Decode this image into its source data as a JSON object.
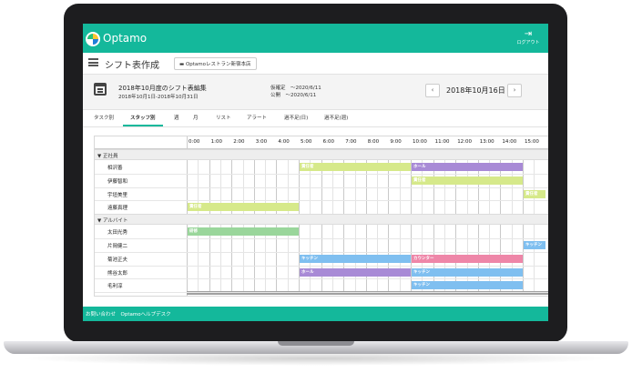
{
  "app": {
    "brand": "Optamo",
    "logout_label": "ログアウト",
    "logout_icon": "logout-icon"
  },
  "header": {
    "page_title": "シフト表作成",
    "store_button": "Optamoレストラン新宿本店",
    "menu_icon": "hamburger-icon"
  },
  "schedule": {
    "name": "2018年10月度のシフト表編集",
    "range": "2018年10月1日-2018年10月31日",
    "deadline": "仮確定　〜2020/6/11",
    "publish": "公開　〜2020/6/11",
    "current_date": "2018年10月16日",
    "prev_label": "‹",
    "next_label": "›"
  },
  "tabs": [
    {
      "label": "タスク別"
    },
    {
      "label": "スタッフ別"
    },
    {
      "label": "週"
    },
    {
      "label": "月"
    },
    {
      "label": "リスト"
    },
    {
      "label": "アラート"
    },
    {
      "label": "過不足(日)"
    },
    {
      "label": "過不足(週)"
    }
  ],
  "active_tab": "スタッフ別",
  "timeline": {
    "hours": [
      "0:00",
      "1:00",
      "2:00",
      "3:00",
      "4:00",
      "5:00",
      "6:00",
      "7:00",
      "8:00",
      "9:00",
      "10:00",
      "11:00",
      "12:00",
      "13:00",
      "14:00",
      "15:00"
    ]
  },
  "groups": [
    {
      "label": "▼ 正社員",
      "staff": [
        {
          "name": "相沢善",
          "shifts": [
            {
              "label": "責任者",
              "start": 5,
              "end": 10,
              "color": "#d6e98a"
            },
            {
              "label": "ホール",
              "start": 10,
              "end": 15,
              "color": "#a88ad6"
            }
          ]
        },
        {
          "name": "伊藤智和",
          "shifts": [
            {
              "label": "責任者",
              "start": 10,
              "end": 15,
              "color": "#d6e98a"
            }
          ]
        },
        {
          "name": "宇垣美里",
          "shifts": [
            {
              "label": "責任者",
              "start": 15,
              "end": 16,
              "color": "#d6e98a"
            }
          ]
        },
        {
          "name": "遠藤真理",
          "shifts": [
            {
              "label": "責任者",
              "start": 0,
              "end": 5,
              "color": "#d6e98a"
            }
          ]
        }
      ]
    },
    {
      "label": "▼ アルバイト",
      "staff": [
        {
          "name": "太田光秀",
          "shifts": [
            {
              "label": "研修",
              "start": 0,
              "end": 5,
              "color": "#9ad69b"
            }
          ]
        },
        {
          "name": "片岡健二",
          "shifts": [
            {
              "label": "キッチン",
              "start": 15,
              "end": 16,
              "color": "#7fbff0"
            }
          ]
        },
        {
          "name": "菊池正夫",
          "shifts": [
            {
              "label": "キッチン",
              "start": 5,
              "end": 10,
              "color": "#7fbff0"
            },
            {
              "label": "カウンター",
              "start": 10,
              "end": 15,
              "color": "#ee86a8"
            }
          ]
        },
        {
          "name": "熊谷太郎",
          "shifts": [
            {
              "label": "ホール",
              "start": 5,
              "end": 10,
              "color": "#a88ad6"
            },
            {
              "label": "キッチン",
              "start": 10,
              "end": 15,
              "color": "#7fbff0"
            }
          ]
        },
        {
          "name": "毛利淳",
          "shifts": [
            {
              "label": "キッチン",
              "start": 10,
              "end": 15,
              "color": "#7fbff0"
            }
          ]
        }
      ]
    }
  ],
  "footer": {
    "text": "お問い合わせ　Optamoヘルプデスク"
  },
  "colors": {
    "accent": "#14b89b",
    "frame": "#1d1d1f"
  }
}
